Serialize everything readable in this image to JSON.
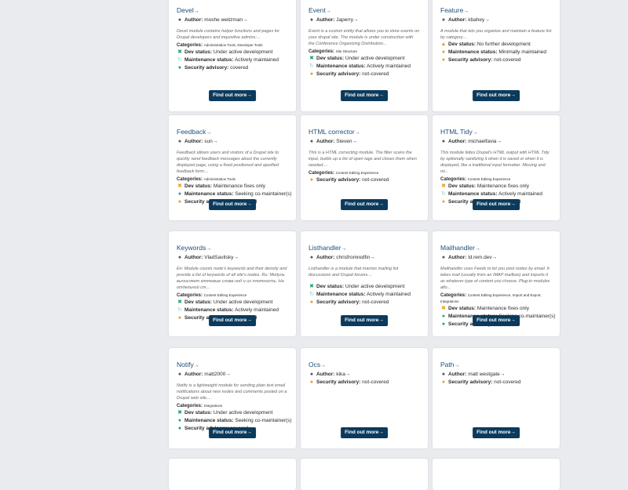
{
  "labels": {
    "author": "Author:",
    "categories": "Categories:",
    "dev": "Dev status:",
    "maint": "Maintenance status:",
    "security": "Security advisory:",
    "button": "Find out more",
    "arrow": "→"
  },
  "cards": [
    {
      "title": "Devel",
      "author": "moshe weitzman",
      "description": "Devel module contains helper functions and pages for Drupal developers and inquisitive admins:...",
      "categories": "Administration Tools, Developer Tools",
      "dev": "Under active development",
      "maint": "Actively maintained",
      "security": "covered"
    },
    {
      "title": "Event",
      "author": "Japerry",
      "description": "Event is a custom entity that allows you to store events on your drupal site. The module is under construction with the Conference Organizing Distribution...",
      "categories": "Site Structure",
      "dev": "Under active development",
      "maint": "Actively maintained",
      "security": "not-covered"
    },
    {
      "title": "Feature",
      "author": "kbahey",
      "description": "A module that lets you organize and maintain a feature list by category....",
      "categories": "",
      "dev": "No further development",
      "maint": "Minimally maintained",
      "security": "not-covered"
    },
    {
      "title": "Feedback",
      "author": "sun",
      "description": "Feedback allows users and visitors of a Drupal site to quickly send feedback messages about the currently displayed page, using a fixed positioned and ajaxified feedback form....",
      "categories": "Administration Tools",
      "dev": "Maintenance fixes only",
      "maint": "Seeking co-maintainer(s)",
      "security": "not-covered"
    },
    {
      "title": "HTML corrector",
      "author": "Steven",
      "description": "This is a HTML correcting module. The filter scans the input, builds up a list of open tags and closes them when needed....",
      "categories": "Content Editing Experience",
      "dev": "",
      "maint": "",
      "security": "not-covered"
    },
    {
      "title": "HTML Tidy",
      "author": "michaelfavia",
      "description": "This module tidies Drupal's HTML output with HTML Tidy by optionally sanitizing it when it is saved or when it is displayed, like a traditional input formatter. Missing and mi...",
      "categories": "Content Editing Experience",
      "dev": "Maintenance fixes only",
      "maint": "Actively maintained",
      "security": "not-covered"
    },
    {
      "title": "Keywords",
      "author": "VladSavitsky",
      "description": "En: Module counts node's keywords and their density and provide a list of keywords of all site's nodes. Ru: Модуль вычисляет ключевые слова нод и их плотность. На отдельной ст...",
      "categories": "Content Editing Experience",
      "dev": "Under active development",
      "maint": "Actively maintained",
      "security": "not-covered"
    },
    {
      "title": "Listhandler",
      "author": "chrisfromredfin",
      "description": "Listhandler is a module that marries mailing list discussions and Drupal forums....",
      "categories": "",
      "dev": "Under active development",
      "maint": "Actively maintained",
      "security": "not-covered"
    },
    {
      "title": "Mailhandler",
      "author": "ld.rem.dev",
      "description": "Mailhandler uses Feeds to let you post nodes by email. It takes mail (usually from an IMAP mailbox) and imports it as whatever type of content you choose. Plug-in modules allo...",
      "categories": "Content Editing Experience, Import and Export, Integrations",
      "dev": "Maintenance fixes only",
      "maint": "Seeking co-maintainer(s)",
      "security": "covered"
    },
    {
      "title": "Notify",
      "author": "matt2000",
      "description": "Notify is a lightweight module for sending plain text email notifications about new nodes and comments posted on a Drupal web site....",
      "categories": "Integrations",
      "dev": "Under active development",
      "maint": "Seeking co-maintainer(s)",
      "security": "covered"
    },
    {
      "title": "Ocs",
      "author": "kika",
      "description": "",
      "categories": "",
      "dev": "",
      "maint": "",
      "security": "not-covered"
    },
    {
      "title": "Path",
      "author": "matt westgate",
      "description": "",
      "categories": "",
      "dev": "",
      "maint": "",
      "security": "not-covered"
    }
  ]
}
